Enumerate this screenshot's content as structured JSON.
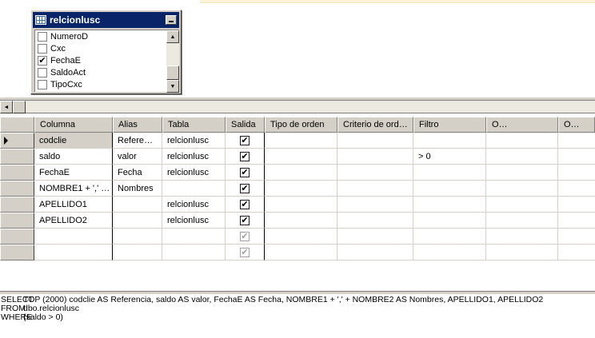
{
  "diagram": {
    "table_title": "relcionlusc",
    "columns": [
      {
        "name": "NumeroD",
        "checked": false
      },
      {
        "name": "Cxc",
        "checked": false
      },
      {
        "name": "FechaE",
        "checked": true
      },
      {
        "name": "SaldoAct",
        "checked": false
      },
      {
        "name": "TipoCxc",
        "checked": false
      }
    ],
    "scroll_up": "▲",
    "scroll_down": "▼",
    "hscroll_left": "◄"
  },
  "grid": {
    "headers": {
      "column": "Columna",
      "alias": "Alias",
      "table": "Tabla",
      "output": "Salida",
      "sort_type": "Tipo de orden",
      "sort_criteria": "Criterio de ord…",
      "filter": "Filtro",
      "or1": "O…",
      "or2": "O…"
    },
    "rows": [
      {
        "column": "codclie",
        "alias": "Refere…",
        "table": "relcionlusc",
        "output": true,
        "filter": "",
        "current": true
      },
      {
        "column": "saldo",
        "alias": "valor",
        "table": "relcionlusc",
        "output": true,
        "filter": "> 0",
        "current": false
      },
      {
        "column": "FechaE",
        "alias": "Fecha",
        "table": "relcionlusc",
        "output": true,
        "filter": "",
        "current": false
      },
      {
        "column": "NOMBRE1 + ',' …",
        "alias": "Nombres",
        "table": "",
        "output": true,
        "filter": "",
        "current": false
      },
      {
        "column": "APELLIDO1",
        "alias": "",
        "table": "relcionlusc",
        "output": true,
        "filter": "",
        "current": false
      },
      {
        "column": "APELLIDO2",
        "alias": "",
        "table": "relcionlusc",
        "output": true,
        "filter": "",
        "current": false
      },
      {
        "column": "",
        "alias": "",
        "table": "",
        "output": true,
        "filter": "",
        "current": false,
        "empty": true
      },
      {
        "column": "",
        "alias": "",
        "table": "",
        "output": true,
        "filter": "",
        "current": false,
        "empty": true
      }
    ]
  },
  "sql": {
    "lines": [
      {
        "keyword": "SELECT",
        "body": "TOP (2000) codclie AS Referencia, saldo AS valor, FechaE AS Fecha, NOMBRE1 + ',' + NOMBRE2 AS Nombres, APELLIDO1, APELLIDO2"
      },
      {
        "keyword": "FROM",
        "body": "dbo.relcionlusc"
      },
      {
        "keyword": "WHERE",
        "body": "(saldo > 0)"
      }
    ]
  },
  "check_glyph": "✔"
}
